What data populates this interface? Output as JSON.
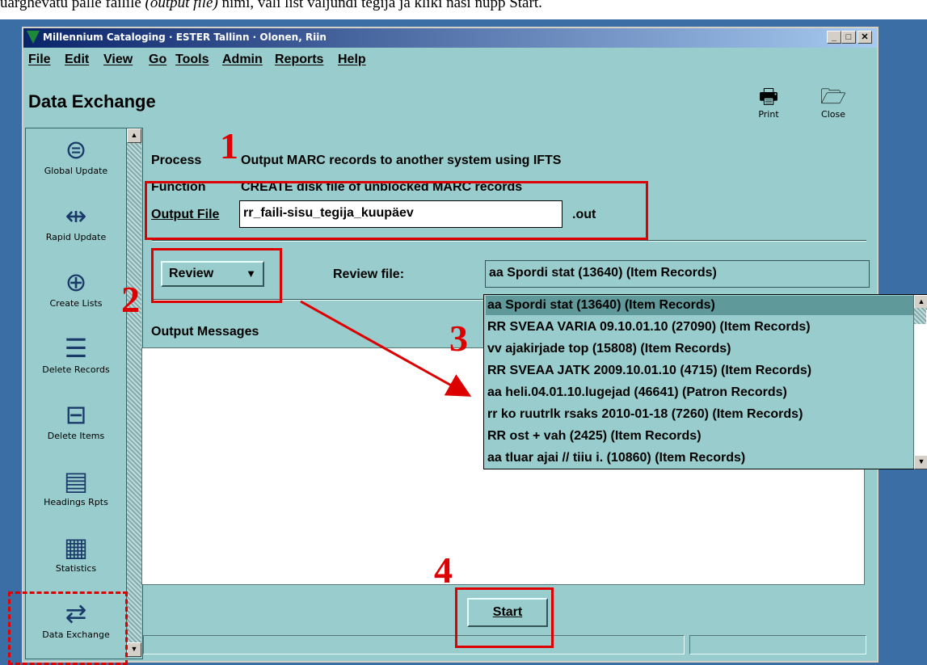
{
  "caption": {
    "before": "üarghevatü palle failile ",
    "italic": "(output file)",
    "after": " nimi, vali list väljundi tegija ja kliki nasi nupp Start."
  },
  "window": {
    "title": "Millennium Cataloging · ESTER Tallinn · Olonen, Riin",
    "minimize": "_",
    "maximize": "□",
    "close": "✕"
  },
  "menu": [
    "File",
    "Edit",
    "View",
    "Go",
    "Tools",
    "Admin",
    "Reports",
    "Help"
  ],
  "header": {
    "title": "Data Exchange",
    "print_label": "Print",
    "close_label": "Close"
  },
  "sidebar": {
    "items": [
      {
        "label": "Global Update"
      },
      {
        "label": "Rapid Update"
      },
      {
        "label": "Create Lists"
      },
      {
        "label": "Delete Records"
      },
      {
        "label": "Delete Items"
      },
      {
        "label": "Headings Rpts"
      },
      {
        "label": "Statistics"
      },
      {
        "label": "Data Exchange"
      }
    ]
  },
  "form": {
    "process_label": "Process",
    "process_value": "Output MARC records to another system using IFTS",
    "function_label": "Function",
    "function_value": "CREATE disk file of unblocked MARC records",
    "output_label": "Output File",
    "output_value": "rr_faili-sisu_tegija_kuupäev",
    "output_ext": ".out",
    "review_button": "Review",
    "review_file_label": "Review file:",
    "review_file_selected": "aa Spordi stat (13640) (Item Records)",
    "messages_label": "Output Messages",
    "start_button": "Start"
  },
  "dropdown": {
    "options": [
      "aa Spordi stat (13640) (Item Records)",
      "RR SVEAA VARIA 09.10.01.10 (27090) (Item Records)",
      "vv ajakirjade top (15808) (Item Records)",
      "RR SVEAA JATK 2009.10.01.10 (4715) (Item Records)",
      "aa heli.04.01.10.lugejad (46641) (Patron Records)",
      "rr ko ruutrlk rsaks 2010-01-18 (7260) (Item Records)",
      "RR ost + vah (2425) (Item Records)",
      "aa tluar ajai // tiiu i. (10860) (Item Records)"
    ]
  },
  "annotations": {
    "n1": "1",
    "n2": "2",
    "n3": "3",
    "n4": "4",
    "color": "#dd0000"
  },
  "icons": {
    "global_update": "refresh-list-icon",
    "rapid_update": "split-arrows-icon",
    "create_lists": "target-arrow-icon",
    "delete_records": "list-delete-icon",
    "delete_items": "item-delete-icon",
    "headings_rpts": "report-icon",
    "statistics": "grid-chart-icon",
    "data_exchange": "exchange-icon",
    "print": "printer-icon",
    "close": "folder-close-icon"
  }
}
